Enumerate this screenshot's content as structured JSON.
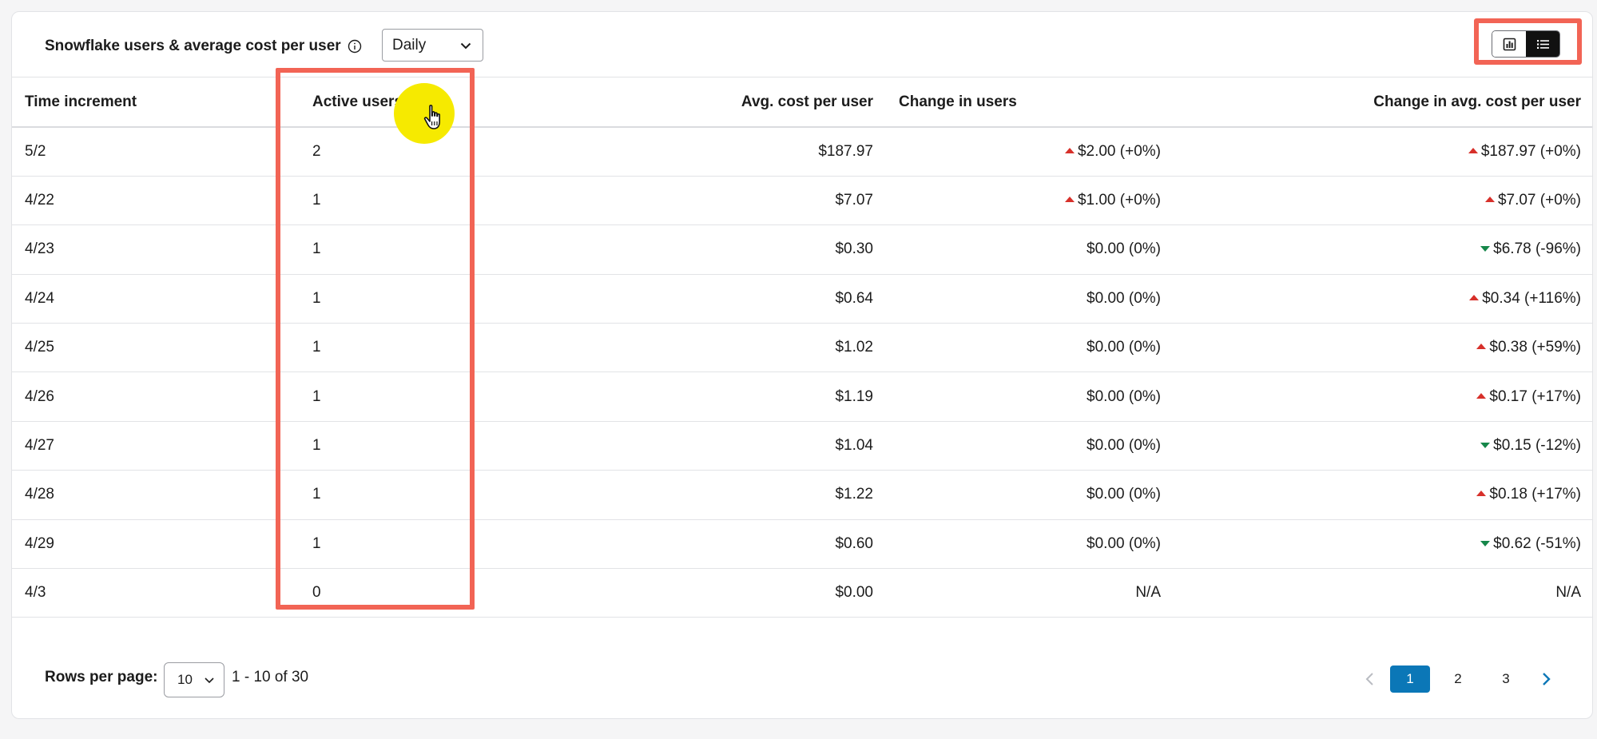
{
  "header": {
    "title": "Snowflake users & average cost per user",
    "info_icon": "info-circle-icon",
    "period_value": "Daily",
    "view_toggle": {
      "chart_icon": "bar-chart-icon",
      "table_icon": "list-icon",
      "active": "table"
    }
  },
  "table": {
    "columns": [
      "Time increment",
      "Active users",
      "Avg. cost per user",
      "Change in users",
      "Change in avg. cost per user"
    ],
    "sorted_by": "Active users",
    "sort_direction": "descending",
    "rows": [
      {
        "time": "5/2",
        "active": "2",
        "avg_cost": "$187.97",
        "change_users": "$2.00 (+0%)",
        "change_users_dir": "up",
        "change_cost": "$187.97 (+0%)",
        "change_cost_dir": "up"
      },
      {
        "time": "4/22",
        "active": "1",
        "avg_cost": "$7.07",
        "change_users": "$1.00 (+0%)",
        "change_users_dir": "up",
        "change_cost": "$7.07 (+0%)",
        "change_cost_dir": "up"
      },
      {
        "time": "4/23",
        "active": "1",
        "avg_cost": "$0.30",
        "change_users": "$0.00 (0%)",
        "change_users_dir": "none",
        "change_cost": "$6.78 (-96%)",
        "change_cost_dir": "down"
      },
      {
        "time": "4/24",
        "active": "1",
        "avg_cost": "$0.64",
        "change_users": "$0.00 (0%)",
        "change_users_dir": "none",
        "change_cost": "$0.34 (+116%)",
        "change_cost_dir": "up"
      },
      {
        "time": "4/25",
        "active": "1",
        "avg_cost": "$1.02",
        "change_users": "$0.00 (0%)",
        "change_users_dir": "none",
        "change_cost": "$0.38 (+59%)",
        "change_cost_dir": "up"
      },
      {
        "time": "4/26",
        "active": "1",
        "avg_cost": "$1.19",
        "change_users": "$0.00 (0%)",
        "change_users_dir": "none",
        "change_cost": "$0.17 (+17%)",
        "change_cost_dir": "up"
      },
      {
        "time": "4/27",
        "active": "1",
        "avg_cost": "$1.04",
        "change_users": "$0.00 (0%)",
        "change_users_dir": "none",
        "change_cost": "$0.15 (-12%)",
        "change_cost_dir": "down"
      },
      {
        "time": "4/28",
        "active": "1",
        "avg_cost": "$1.22",
        "change_users": "$0.00 (0%)",
        "change_users_dir": "none",
        "change_cost": "$0.18 (+17%)",
        "change_cost_dir": "up"
      },
      {
        "time": "4/29",
        "active": "1",
        "avg_cost": "$0.60",
        "change_users": "$0.00 (0%)",
        "change_users_dir": "none",
        "change_cost": "$0.62 (-51%)",
        "change_cost_dir": "down"
      },
      {
        "time": "4/3",
        "active": "0",
        "avg_cost": "$0.00",
        "change_users": "N/A",
        "change_users_dir": "none",
        "change_cost": "N/A",
        "change_cost_dir": "none"
      }
    ]
  },
  "footer": {
    "rows_per_page_label": "Rows per page:",
    "rows_per_page_value": "10",
    "range_text": "1 - 10 of 30",
    "pages": [
      "1",
      "2",
      "3"
    ],
    "current_page": "1"
  },
  "colors": {
    "increase": "#d7302a",
    "decrease": "#16874a",
    "pagination_active": "#0b77b7",
    "annotation_highlight": "#f26455",
    "cursor_highlight": "#f6ea00"
  }
}
